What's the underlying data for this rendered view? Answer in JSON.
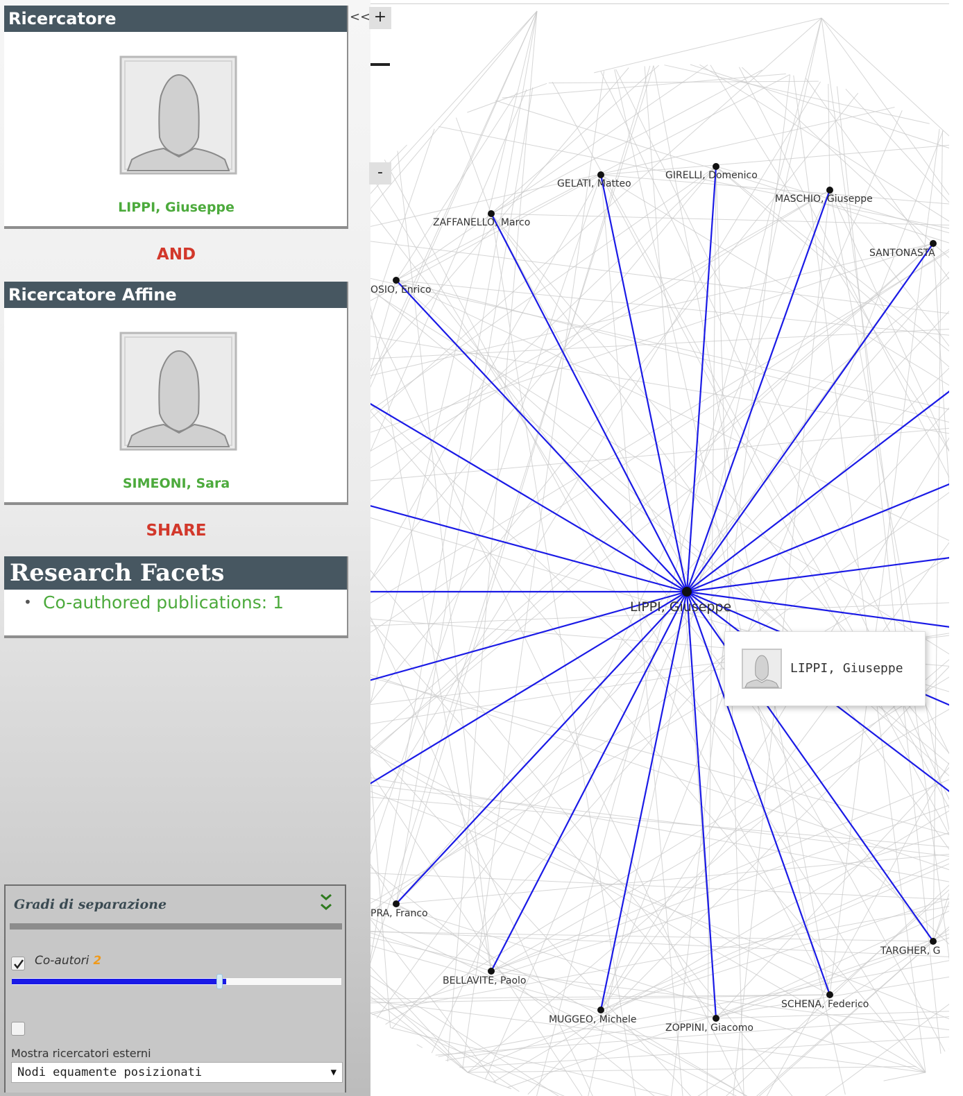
{
  "researcher_card": {
    "title": "Ricercatore",
    "name": "LIPPI, Giuseppe"
  },
  "connector_and": "AND",
  "affine_card": {
    "title": "Ricercatore Affine",
    "name": "SIMEONI, Sara"
  },
  "connector_share": "SHARE",
  "facets": {
    "title": "Research Facets",
    "items": [
      "Co-authored publications: 1"
    ]
  },
  "settings": {
    "title": "Gradi di separazione",
    "coauthors_label": "Co-autori",
    "coauthors_value": "2",
    "coauthors_checked": true,
    "slider_fraction": 0.65,
    "external_checked": false,
    "external_label": "Mostra ricercatori esterni",
    "layout_selected": "Nodi equamente posizionati"
  },
  "panel_toggle": "<<",
  "zoom": {
    "in_label": "+",
    "out_label": "-"
  },
  "graph": {
    "center_label": "LIPPI, Giuseppe",
    "nodes": [
      "GELATI, Matteo",
      "GIRELLI, Domenico",
      "MASCHIO, Giuseppe",
      "ZAFFANELLO, Marco",
      "SANTONASTA",
      "OSIO, Enrico",
      "PRA, Franco",
      "TARGHER, G",
      "BELLAVITE, Paolo",
      "SCHENA, Federico",
      "MUGGEO, Michele",
      "ZOPPINI, Giacomo"
    ],
    "edge_color": "#1a1ae6",
    "background_edge_color": "#c8c8c8"
  },
  "tooltip": {
    "name": "LIPPI, Giuseppe"
  }
}
